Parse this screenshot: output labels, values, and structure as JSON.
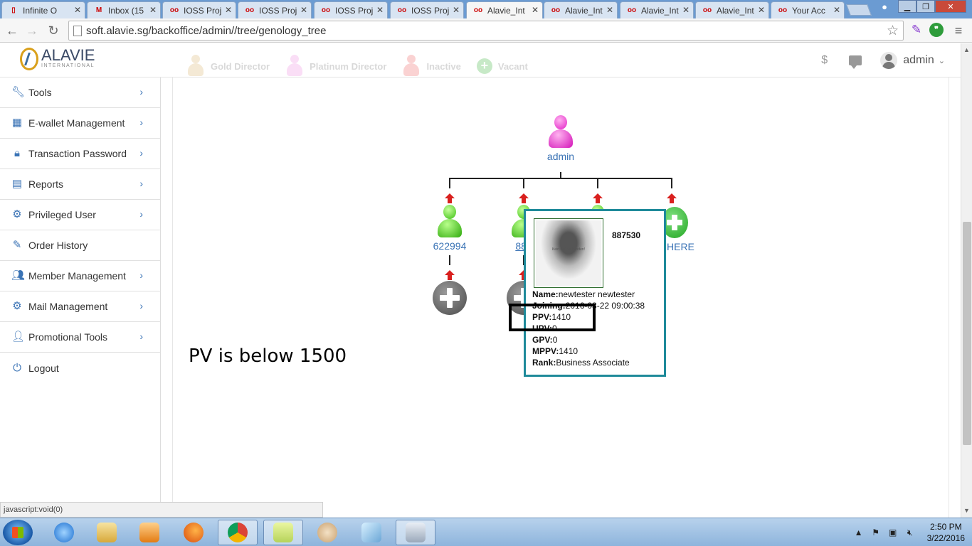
{
  "browser": {
    "tabs": [
      {
        "label": "Infinite O",
        "icon": "page-icon"
      },
      {
        "label": "Inbox (15",
        "icon": "gmail-icon"
      },
      {
        "label": "IOSS Proj",
        "icon": "ioss-icon"
      },
      {
        "label": "IOSS Proj",
        "icon": "ioss-icon"
      },
      {
        "label": "IOSS Proj",
        "icon": "ioss-icon"
      },
      {
        "label": "IOSS Proj",
        "icon": "ioss-icon"
      },
      {
        "label": "Alavie_Int",
        "icon": "ioss-icon",
        "active": true
      },
      {
        "label": "Alavie_Int",
        "icon": "ioss-icon"
      },
      {
        "label": "Alavie_Int",
        "icon": "ioss-icon"
      },
      {
        "label": "Alavie_Int",
        "icon": "ioss-icon"
      },
      {
        "label": "Your Acc",
        "icon": "ioss-icon"
      }
    ],
    "url": "soft.alavie.sg/backoffice/admin//tree/genology_tree",
    "status_text": "javascript:void(0)"
  },
  "header": {
    "logo_name": "ALAVIE",
    "logo_sub": "INTERNATIONAL",
    "legend": [
      {
        "label": "Gold Director",
        "color": "#d8b36a"
      },
      {
        "label": "Platinum Director",
        "color": "#f08adf"
      },
      {
        "label": "Inactive",
        "color": "#f06060"
      },
      {
        "label": "Vacant",
        "color": "#3bb43b"
      }
    ],
    "currency_symbol": "$",
    "user_name": "admin"
  },
  "sidebar": {
    "items": [
      {
        "label": "Tools",
        "icon": "wrench-icon"
      },
      {
        "label": "E-wallet Management",
        "icon": "calendar-icon"
      },
      {
        "label": "Transaction Password",
        "icon": "lock-icon"
      },
      {
        "label": "Reports",
        "icon": "report-icon"
      },
      {
        "label": "Privileged User",
        "icon": "gear-icon"
      },
      {
        "label": "Order History",
        "icon": "edit-icon"
      },
      {
        "label": "Member Management",
        "icon": "users-icon"
      },
      {
        "label": "Mail Management",
        "icon": "gear-icon"
      },
      {
        "label": "Promotional Tools",
        "icon": "user-icon"
      },
      {
        "label": "Logout",
        "icon": "power-icon"
      }
    ]
  },
  "tree": {
    "root": {
      "label": "admin"
    },
    "children": [
      {
        "label": "622994"
      },
      {
        "label": "887"
      },
      {
        "label": ""
      },
      {
        "label": "HERE"
      }
    ]
  },
  "annotation": {
    "text": "PV is below 1500"
  },
  "popup": {
    "id": "887530",
    "photo_text": "Kein Bild vorhanden!",
    "rows": [
      {
        "key": "Name:",
        "value": "newtester newtester"
      },
      {
        "key": "Joining:",
        "value": "2016-03-22 09:00:38"
      },
      {
        "key": "PPV:",
        "value": "1410"
      },
      {
        "key": "UPV:",
        "value": "0"
      },
      {
        "key": "GPV:",
        "value": "0"
      },
      {
        "key": "MPPV:",
        "value": "1410"
      },
      {
        "key": "Rank:",
        "value": "Business Associate"
      }
    ]
  },
  "taskbar": {
    "time": "2:50 PM",
    "date": "3/22/2016"
  }
}
